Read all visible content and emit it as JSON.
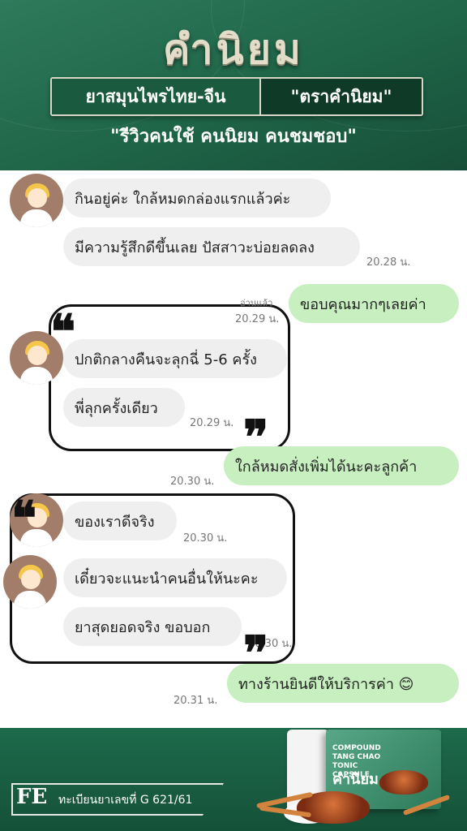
{
  "header": {
    "logo": "คำนิยม",
    "banner_left": "ยาสมุนไพรไทย-จีน",
    "banner_right": "\"ตราคำนิยม\"",
    "tagline": "\"รีวิวคนใช้ คนนิยม คนชมชอบ\""
  },
  "messages": [
    {
      "text": "กินอยู่ค่ะ ใกล้หมดกล่องแรกแล้วค่ะ",
      "side": "in"
    },
    {
      "text": "มีความรู้สึกดีขึ้นเลย ปัสสาวะบ่อยลดลง",
      "side": "in",
      "time": "20.28 น."
    },
    {
      "text": "ขอบคุณมากๆเลยค่า",
      "side": "out",
      "read": "อ่านแล้ว",
      "time": "20.29 น."
    },
    {
      "text": "ปกติกลางคืนจะลุกฉี่ 5-6 ครั้ง",
      "side": "in"
    },
    {
      "text": "พี่ลุกครั้งเดียว",
      "side": "in",
      "time": "20.29 น."
    },
    {
      "text": "ใกล้หมดสั่งเพิ่มได้นะคะลูกค้า",
      "side": "out",
      "time": "20.30 น."
    },
    {
      "text": "ของเราดีจริง",
      "side": "in",
      "time": "20.30 น."
    },
    {
      "text": "เดี๋ยวจะแนะนำคนอื่นให้นะคะ",
      "side": "in"
    },
    {
      "text": "ยาสุดยอดจริง ขอบอก",
      "side": "in",
      "time": "20.30 น."
    },
    {
      "text": "ทางร้านยินดีให้บริการค่า 😊",
      "side": "out",
      "time": "20.31 น."
    }
  ],
  "quote_mark": "❝",
  "quote_mark_close": "❞",
  "footer": {
    "reg_mark": "FE",
    "registration": "ทะเบียนยาเลขที่ G 621/61",
    "box_text": "COMPOUND TANG CHAO TONIC CAPSULE",
    "box_brand": "คำนิยม"
  },
  "colors": {
    "header_green": "#1f6548",
    "incoming_bubble": "#efefef",
    "outgoing_bubble": "#c7efbf"
  }
}
